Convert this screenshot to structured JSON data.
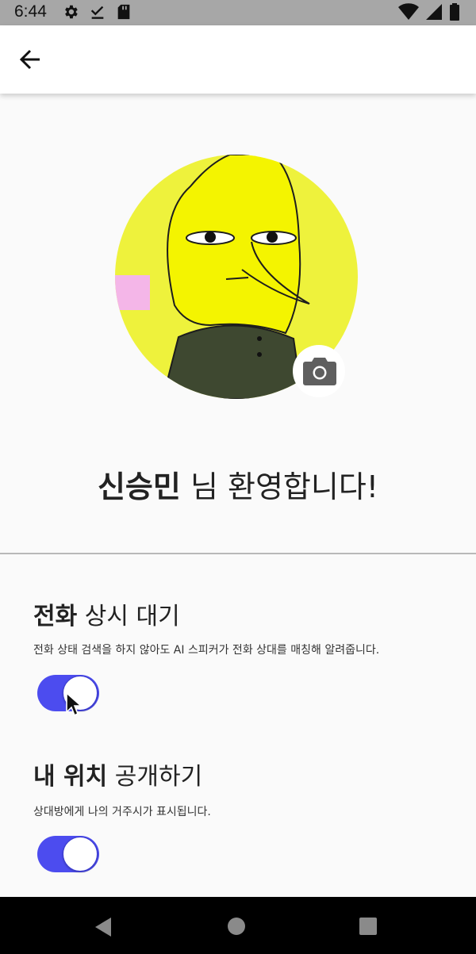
{
  "status_bar": {
    "time": "6:44",
    "icons_left": [
      "gear-icon",
      "download-check-icon",
      "sd-card-icon"
    ],
    "icons_right": [
      "wifi-icon",
      "signal-icon",
      "battery-icon"
    ]
  },
  "app_bar": {
    "back_icon": "arrow-left-icon"
  },
  "profile": {
    "avatar_description": "profile-avatar",
    "camera_icon": "camera-icon"
  },
  "welcome": {
    "name": "신승민",
    "suffix": " 님 환영합니다!"
  },
  "settings": [
    {
      "title_bold": "전화",
      "title_rest": " 상시 대기",
      "description": "전화 상태 검색을 하지 않아도 AI 스피커가 전화 상대를 매칭해 알려줍니다.",
      "enabled": true
    },
    {
      "title_bold": "내 위치",
      "title_rest": " 공개하기",
      "description": "상대방에게 나의 거주시가 표시됩니다.",
      "enabled": true
    }
  ],
  "colors": {
    "accent": "#4c4cef",
    "status_bar": "#a7a7a7",
    "nav_bar": "#000000",
    "avatar_bg": "#eef23c"
  },
  "nav_bar": {
    "buttons": [
      "back-triangle-icon",
      "home-circle-icon",
      "recents-square-icon"
    ]
  }
}
